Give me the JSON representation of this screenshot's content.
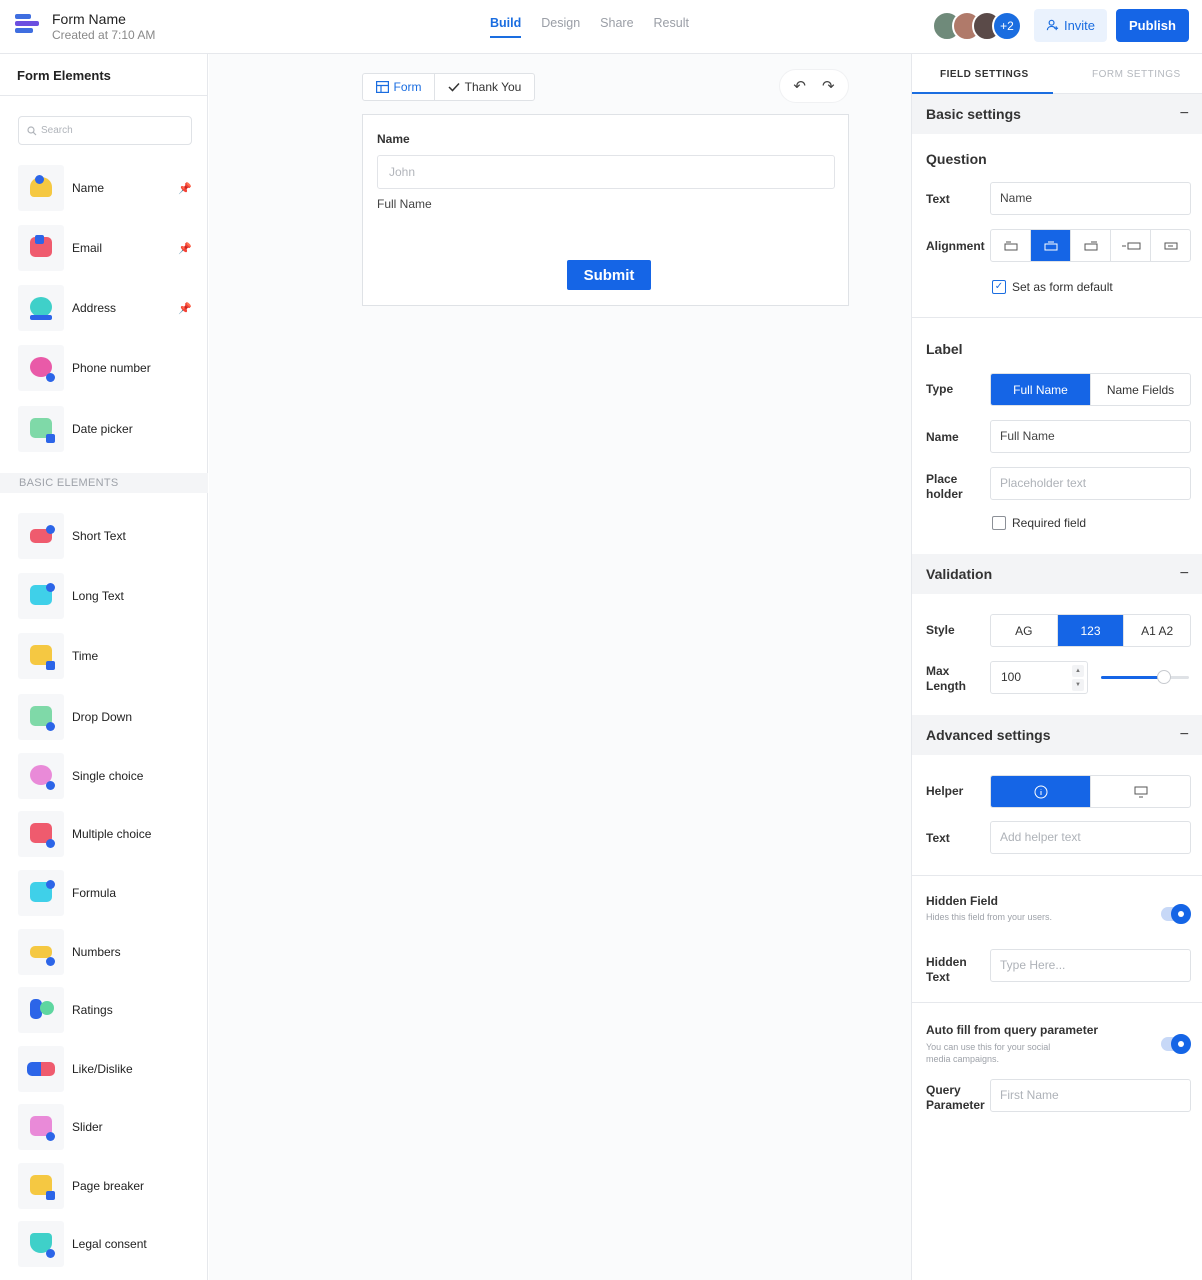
{
  "header": {
    "title": "Form Name",
    "subtitle": "Created at 7:10 AM",
    "nav": [
      "Build",
      "Design",
      "Share",
      "Result"
    ],
    "active_nav": "Build",
    "avatars_more": "+2",
    "invite_label": "Invite",
    "publish_label": "Publish"
  },
  "left": {
    "title": "Form Elements",
    "search_placeholder": "Search",
    "pinned": [
      {
        "label": "Name",
        "color": "#f5c842"
      },
      {
        "label": "Email",
        "color": "#ef5b6e"
      },
      {
        "label": "Address",
        "color": "#3fd0c9"
      },
      {
        "label": "Phone number",
        "color": "#e95aa8"
      },
      {
        "label": "Date picker",
        "color": "#7fd9a8"
      }
    ],
    "section_label": "BASIC ELEMENTS",
    "basic": [
      {
        "label": "Short Text",
        "color": "#ef5b6e"
      },
      {
        "label": "Long Text",
        "color": "#3fd0e9"
      },
      {
        "label": "Time",
        "color": "#f5c842"
      },
      {
        "label": "Drop Down",
        "color": "#7fd9a8"
      },
      {
        "label": "Single choice",
        "color": "#e98ad8"
      },
      {
        "label": "Multiple choice",
        "color": "#ef5b6e"
      },
      {
        "label": "Formula",
        "color": "#3fd0e9"
      },
      {
        "label": "Numbers",
        "color": "#f5c842"
      },
      {
        "label": "Ratings",
        "color": "#2c65e8"
      },
      {
        "label": "Like/Dislike",
        "color": "#ef5b6e"
      },
      {
        "label": "Slider",
        "color": "#e98ad8"
      },
      {
        "label": "Page breaker",
        "color": "#f5c842"
      },
      {
        "label": "Legal consent",
        "color": "#3fd0c9"
      }
    ]
  },
  "canvas": {
    "tab_form": "Form",
    "tab_thanks": "Thank You",
    "question": "Name",
    "input_placeholder": "John",
    "caption": "Full Name",
    "submit": "Submit"
  },
  "right": {
    "tab_field": "FIELD SETTINGS",
    "tab_form": "FORM SETTINGS",
    "basic": {
      "title": "Basic settings",
      "question_title": "Question",
      "text_label": "Text",
      "text_value": "Name",
      "alignment_label": "Alignment",
      "default_label": "Set as form default"
    },
    "label": {
      "title": "Label",
      "type_label": "Type",
      "type_options": [
        "Full Name",
        "Name Fields"
      ],
      "name_label": "Name",
      "name_value": "Full Name",
      "placeholder_label_1": "Place",
      "placeholder_label_2": "holder",
      "placeholder_placeholder": "Placeholder text",
      "required_label": "Required field"
    },
    "validation": {
      "title": "Validation",
      "style_label": "Style",
      "style_options": [
        "AG",
        "123",
        "A1 A2"
      ],
      "max_label_1": "Max",
      "max_label_2": "Length",
      "max_value": "100",
      "slider_fraction": 0.72
    },
    "advanced": {
      "title": "Advanced settings",
      "helper_label": "Helper",
      "text_label": "Text",
      "text_placeholder": "Add helper text",
      "hidden_title": "Hidden Field",
      "hidden_desc": "Hides this field from your users.",
      "hidden_text_1": "Hidden",
      "hidden_text_2": "Text",
      "hidden_placeholder": "Type Here...",
      "autofill_title": "Auto fill from query parameter",
      "autofill_desc": "You can use this for your social media campaigns.",
      "query_1": "Query",
      "query_2": "Parameter",
      "query_placeholder": "First Name"
    }
  }
}
